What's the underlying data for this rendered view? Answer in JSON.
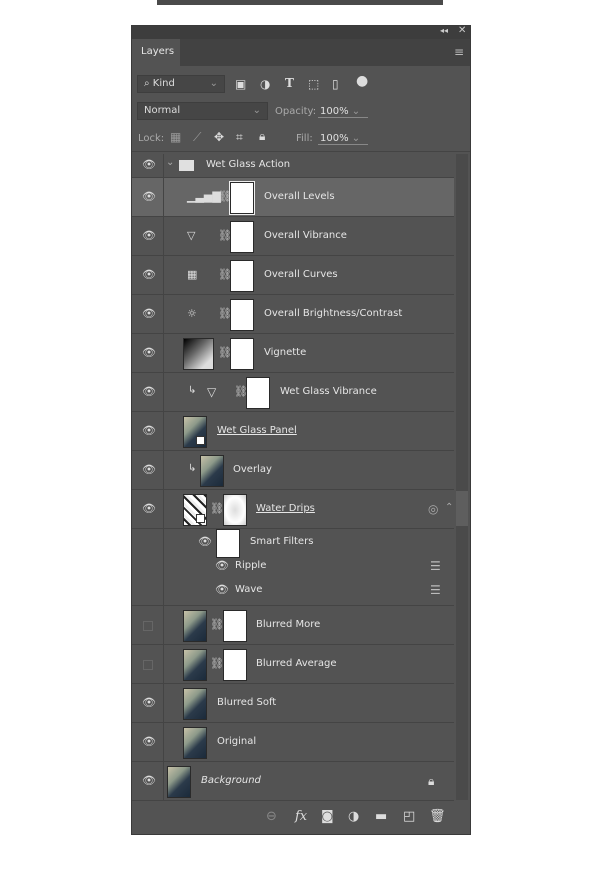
{
  "panel": {
    "tab": "Layers",
    "collapse_icon": "double-chevron-left",
    "close_icon": "close",
    "menu_icon": "hamburger"
  },
  "filter": {
    "kind": "Kind",
    "icons": [
      "image-filter-icon",
      "adjustment-filter-icon",
      "type-filter-icon",
      "shape-filter-icon",
      "smart-object-filter-icon",
      "filter-toggle-icon"
    ]
  },
  "blend": {
    "mode": "Normal",
    "opacity_label": "Opacity:",
    "opacity": "100%"
  },
  "lock": {
    "label": "Lock:",
    "fill_label": "Fill:",
    "fill": "100%"
  },
  "layers": [
    {
      "name": "Wet Glass Action",
      "type": "group",
      "visible": true
    },
    {
      "name": "Overall Levels",
      "type": "adjust",
      "icon": "levels",
      "visible": true,
      "selected": true
    },
    {
      "name": "Overall Vibrance",
      "type": "adjust",
      "icon": "vibrance",
      "visible": true
    },
    {
      "name": "Overall Curves",
      "type": "adjust",
      "icon": "curves",
      "visible": true
    },
    {
      "name": "Overall Brightness/Contrast",
      "type": "adjust",
      "icon": "brightness",
      "visible": true
    },
    {
      "name": "Vignette",
      "type": "gradient",
      "visible": true
    },
    {
      "name": "Wet Glass Vibrance",
      "type": "adjust-clip",
      "icon": "vibrance",
      "visible": true
    },
    {
      "name": "Wet Glass Panel",
      "type": "smart",
      "visible": true
    },
    {
      "name": "Overlay",
      "type": "photo-clip",
      "visible": true
    },
    {
      "name": "Water Drips",
      "type": "smart-mask",
      "visible": true
    },
    {
      "name": "Smart Filters",
      "type": "smart-filters",
      "visible": true
    },
    {
      "name": "Ripple",
      "type": "filter",
      "visible": true
    },
    {
      "name": "Wave",
      "type": "filter",
      "visible": true
    },
    {
      "name": "Blurred More",
      "type": "photo-mask",
      "visible": false
    },
    {
      "name": "Blurred Average",
      "type": "photo-mask",
      "visible": false
    },
    {
      "name": "Blurred Soft",
      "type": "photo",
      "visible": true
    },
    {
      "name": "Original",
      "type": "photo",
      "visible": true
    },
    {
      "name": "Background",
      "type": "background",
      "visible": true,
      "locked": true
    }
  ],
  "footer": {
    "icons": [
      "link-layers",
      "fx",
      "add-mask",
      "new-adjustment",
      "new-group",
      "new-layer",
      "delete"
    ],
    "fx_label": "fx"
  }
}
